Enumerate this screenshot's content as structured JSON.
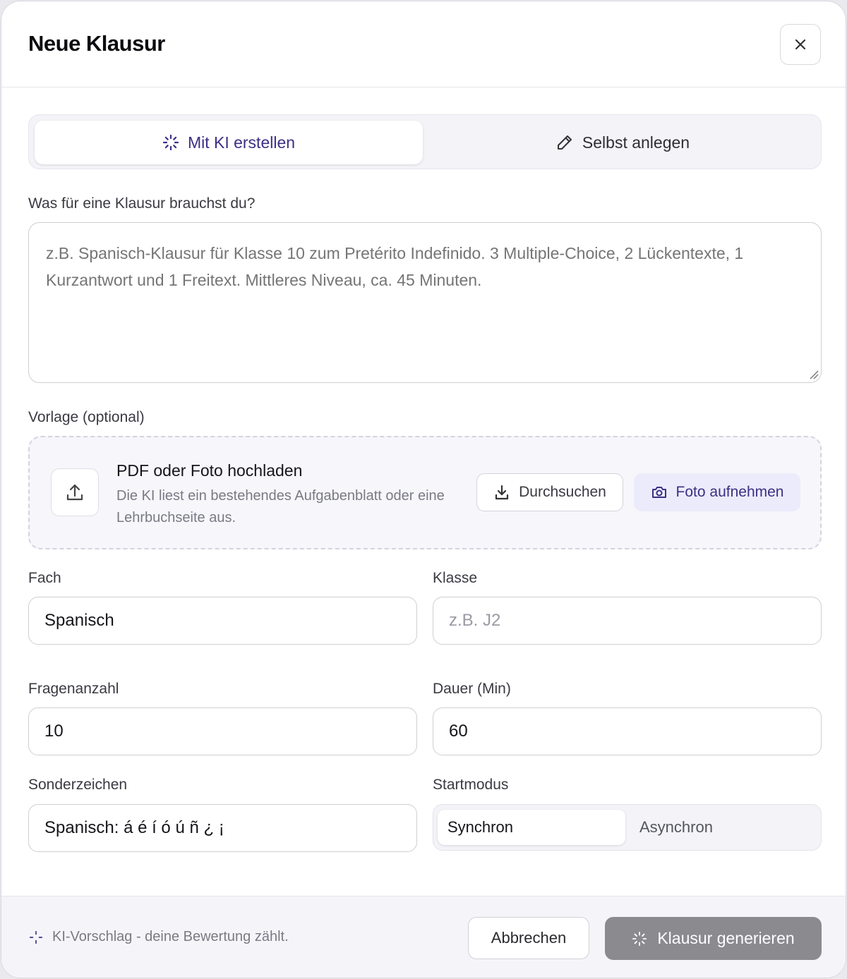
{
  "dialog": {
    "title": "Neue Klausur"
  },
  "tabs": {
    "ai_label": "Mit KI erstellen",
    "manual_label": "Selbst anlegen"
  },
  "prompt": {
    "label": "Was für eine Klausur brauchst du?",
    "placeholder": "z.B. Spanisch-Klausur für Klasse 10 zum Pretérito Indefinido. 3 Multiple-Choice, 2 Lückentexte, 1 Kurzantwort und 1 Freitext. Mittleres Niveau, ca. 45 Minuten."
  },
  "template": {
    "label": "Vorlage (optional)",
    "title": "PDF oder Foto hochladen",
    "description": "Die KI liest ein bestehendes Aufgabenblatt oder eine Lehrbuchseite aus.",
    "browse_label": "Durchsuchen",
    "photo_label": "Foto aufnehmen"
  },
  "fields": {
    "subject_label": "Fach",
    "subject_value": "Spanisch",
    "class_label": "Klasse",
    "class_placeholder": "z.B. J2",
    "questions_label": "Fragenanzahl",
    "questions_value": "10",
    "duration_label": "Dauer (Min)",
    "duration_value": "60",
    "special_label": "Sonderzeichen",
    "special_value": "Spanisch: á é í ó ú ñ ¿ ¡",
    "mode_label": "Startmodus",
    "mode_sync": "Synchron",
    "mode_async": "Asynchron"
  },
  "footer": {
    "hint": "KI-Vorschlag - deine Bewertung zählt.",
    "cancel_label": "Abbrechen",
    "generate_label": "Klausur generieren"
  },
  "colors": {
    "accent": "#3c2f85",
    "accent_bg": "#ecebfb",
    "disabled_button": "#8a8a8f"
  }
}
